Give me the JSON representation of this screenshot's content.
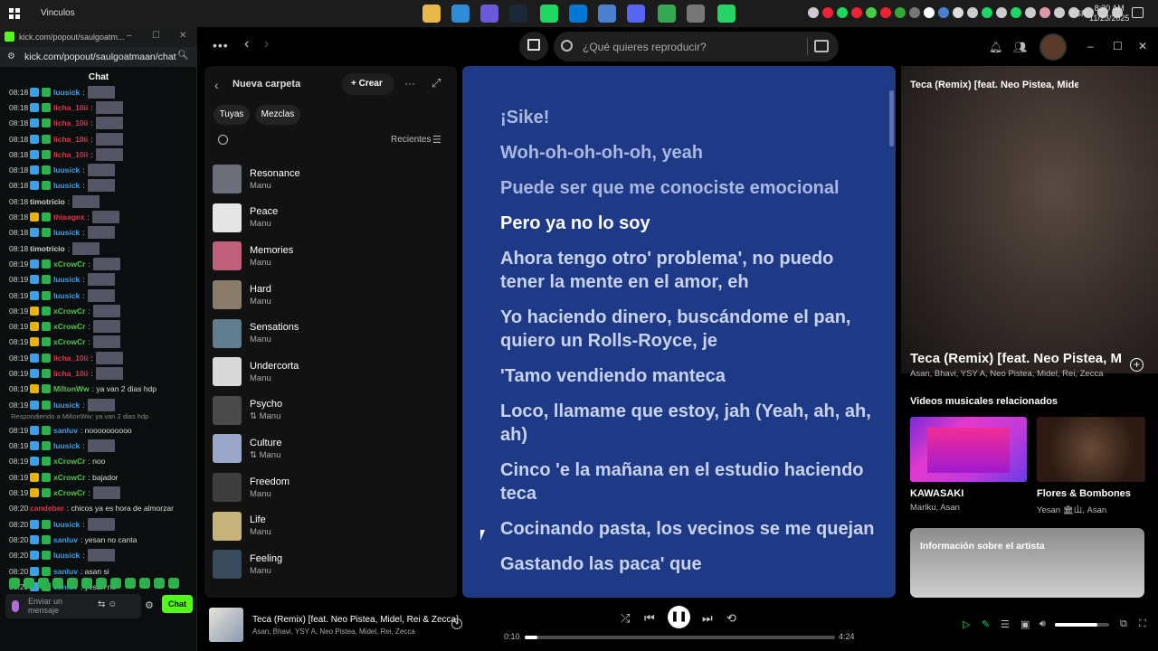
{
  "taskbar": {
    "window_title": "Vinculos",
    "apps": [
      "file-explorer-icon",
      "chrome-icon",
      "copilot-icon",
      "steam-icon",
      "spotify-icon",
      "store-icon",
      "files-icon",
      "discord-icon",
      "chrome-profile-icon",
      "settings-icon",
      "whatsapp-icon"
    ],
    "language": "ESP",
    "time": "8:20 AM",
    "date": "11/23/2025"
  },
  "kick": {
    "tab_title": "kick.com/popout/saulgoatm...",
    "url": "kick.com/popout/saulgoatmaan/chat",
    "chat_header": "Chat",
    "messages": [
      {
        "time": "08:18",
        "user": "luusick",
        "color": "#3aa0e8",
        "text": ":",
        "badge": "b1"
      },
      {
        "time": "08:18",
        "user": "licha_10ii",
        "color": "#e0344b",
        "text": ":",
        "badge": "b1"
      },
      {
        "time": "08:18",
        "user": "licha_10ii",
        "color": "#e0344b",
        "text": ":",
        "badge": "b1"
      },
      {
        "time": "08:18",
        "user": "licha_10ii",
        "color": "#e0344b",
        "text": ":",
        "badge": "b1"
      },
      {
        "time": "08:18",
        "user": "licha_10ii",
        "color": "#e0344b",
        "text": ":",
        "badge": "b1"
      },
      {
        "time": "08:18",
        "user": "luusick",
        "color": "#3aa0e8",
        "text": ":",
        "badge": "b1"
      },
      {
        "time": "08:18",
        "user": "luusick",
        "color": "#3aa0e8",
        "text": ":",
        "badge": "b1"
      },
      {
        "time": "08:18",
        "user": "timotricio",
        "color": "#cfcfcf",
        "text": ":",
        "badge": ""
      },
      {
        "time": "08:18",
        "user": "thisagex",
        "color": "#e0344b",
        "text": ":",
        "badge": "b2"
      },
      {
        "time": "08:18",
        "user": "luusick",
        "color": "#3aa0e8",
        "text": ":",
        "badge": "b1"
      },
      {
        "time": "08:18",
        "user": "timotricio",
        "color": "#cfcfcf",
        "text": ":",
        "badge": ""
      },
      {
        "time": "08:19",
        "user": "xCrowCr",
        "color": "#53c44a",
        "text": ":",
        "badge": "b1"
      },
      {
        "time": "08:19",
        "user": "luusick",
        "color": "#3aa0e8",
        "text": ":",
        "badge": "b1"
      },
      {
        "time": "08:19",
        "user": "luusick",
        "color": "#3aa0e8",
        "text": ":",
        "badge": "b1"
      },
      {
        "time": "08:19",
        "user": "xCrowCr",
        "color": "#53c44a",
        "text": ":",
        "badge": "b2"
      },
      {
        "time": "08:19",
        "user": "xCrowCr",
        "color": "#53c44a",
        "text": ":",
        "badge": "b2"
      },
      {
        "time": "08:19",
        "user": "xCrowCr",
        "color": "#53c44a",
        "text": ":",
        "badge": "b2"
      },
      {
        "time": "08:19",
        "user": "licha_10ii",
        "color": "#e0344b",
        "text": ":",
        "badge": "b1"
      },
      {
        "time": "08:19",
        "user": "licha_10ii",
        "color": "#e0344b",
        "text": ":",
        "badge": "b1"
      },
      {
        "time": "08:19",
        "user": "MiltonWw",
        "color": "#53c44a",
        "text": ": ya van 2 dias hdp",
        "badge": "b2"
      },
      {
        "time": "08:19",
        "user": "luusick",
        "color": "#3aa0e8",
        "text": ":",
        "badge": "b1"
      }
    ],
    "reply_context": "Respondiendo a MiltonWw: ya van 2 dias hdp",
    "messages2": [
      {
        "time": "08:19",
        "user": "sanluv",
        "color": "#3aa0e8",
        "text": ": noooooooooo",
        "badge": "b1"
      },
      {
        "time": "08:19",
        "user": "luusick",
        "color": "#3aa0e8",
        "text": ":",
        "badge": "b1"
      },
      {
        "time": "08:19",
        "user": "xCrowCr",
        "color": "#53c44a",
        "text": ": noo",
        "badge": "b1"
      },
      {
        "time": "08:19",
        "user": "xCrowCr",
        "color": "#53c44a",
        "text": ": bajador",
        "badge": "b2"
      },
      {
        "time": "08:19",
        "user": "xCrowCr",
        "color": "#53c44a",
        "text": ":",
        "badge": "b2"
      },
      {
        "time": "08:20",
        "user": "candeber",
        "color": "#e0344b",
        "text": ": chicos ya es hora de almorzar",
        "badge": ""
      },
      {
        "time": "08:20",
        "user": "luusick",
        "color": "#3aa0e8",
        "text": ":",
        "badge": "b1"
      },
      {
        "time": "08:20",
        "user": "sanluv",
        "color": "#3aa0e8",
        "text": ": yesan no canta",
        "badge": "b1"
      },
      {
        "time": "08:20",
        "user": "luusick",
        "color": "#3aa0e8",
        "text": ":",
        "badge": "b1"
      },
      {
        "time": "08:20",
        "user": "sanluv",
        "color": "#3aa0e8",
        "text": ": asan si",
        "badge": "b1"
      },
      {
        "time": "08:20",
        "user": "sanluv",
        "color": "#3aa0e8",
        "text": ": yesan no",
        "badge": "b1"
      }
    ],
    "input_placeholder": "Enviar un mensaje",
    "send_label": "Chat"
  },
  "spotify": {
    "search_placeholder": "¿Qué quieres reproducir?",
    "library": {
      "title": "Nueva carpeta",
      "create_label": "Crear",
      "chips": [
        "Tuyas",
        "Mezclas"
      ],
      "sort_label": "Recientes",
      "playlists": [
        {
          "name": "Resonance",
          "owner": "Manu",
          "color": "#6b6f7a"
        },
        {
          "name": "Peace",
          "owner": "Manu",
          "color": "#e5e5e5"
        },
        {
          "name": "Memories",
          "owner": "Manu",
          "color": "#c0607a"
        },
        {
          "name": "Hard",
          "owner": "Manu",
          "color": "#8a7b6a"
        },
        {
          "name": "Sensations",
          "owner": "Manu",
          "color": "#5f7d8c"
        },
        {
          "name": "Undercorta",
          "owner": "Manu",
          "color": "#d9d9d9"
        },
        {
          "name": "Psycho",
          "owner": "⇅ Manu",
          "color": "#4a4a4a"
        },
        {
          "name": "Culture",
          "owner": "⇅ Manu",
          "color": "#9aa7c9"
        },
        {
          "name": "Freedom",
          "owner": "Manu",
          "color": "#3d3d3d"
        },
        {
          "name": "Life",
          "owner": "Manu",
          "color": "#c4b37a"
        },
        {
          "name": "Feeling",
          "owner": "Manu",
          "color": "#3b4b5e"
        }
      ]
    },
    "lyrics": [
      {
        "text": "¡Sike!",
        "state": "past"
      },
      {
        "text": "Woh-oh-oh-oh-oh, yeah",
        "state": "past"
      },
      {
        "text": "Puede ser que me conociste emocional",
        "state": "past"
      },
      {
        "text": "Pero ya no lo soy",
        "state": "cur"
      },
      {
        "text": "Ahora tengo otro' problema', no puedo tener la mente en el amor, eh",
        "state": "fut"
      },
      {
        "text": "Yo haciendo dinero, buscándome el pan, quiero un Rolls-Royce, je",
        "state": "fut"
      },
      {
        "text": "'Tamo vendiendo manteca",
        "state": "fut"
      },
      {
        "text": "Loco, llamame que estoy, jah (Yeah, ah, ah, ah)",
        "state": "fut"
      },
      {
        "text": "Cinco 'e la mañana en el estudio haciendo teca",
        "state": "fut"
      },
      {
        "text": "Cocinando pasta, los vecinos se me quejan",
        "state": "fut"
      },
      {
        "text": "Gastando las paca' que",
        "state": "fut"
      }
    ],
    "now_playing": {
      "top_title": "Teca (Remix) [feat. Neo Pistea, Midel, R",
      "title": "Teca (Remix) [feat. Neo Pistea, M",
      "artists": "Asan, Bhavi, YSY A, Neo Pistea, Midel, Rei, Zecca",
      "related_header": "Videos musicales relacionados",
      "videos": [
        {
          "title": "KAWASAKI",
          "sub": "Marlku, Asan"
        },
        {
          "title": "Flores & Bombones",
          "sub": "Yesan 🏛山, Asan"
        }
      ],
      "artist_info": "Información sobre el artista"
    },
    "player": {
      "title": "Teca (Remix) [feat. Neo Pistea, Midel, Rei & Zecca]",
      "artists": "Asan, Bhavi, YSY A, Neo Pistea, Midel, Rei, Zecca",
      "elapsed": "0:10",
      "total": "4:24",
      "progress": 0.04,
      "volume": 0.78
    }
  }
}
